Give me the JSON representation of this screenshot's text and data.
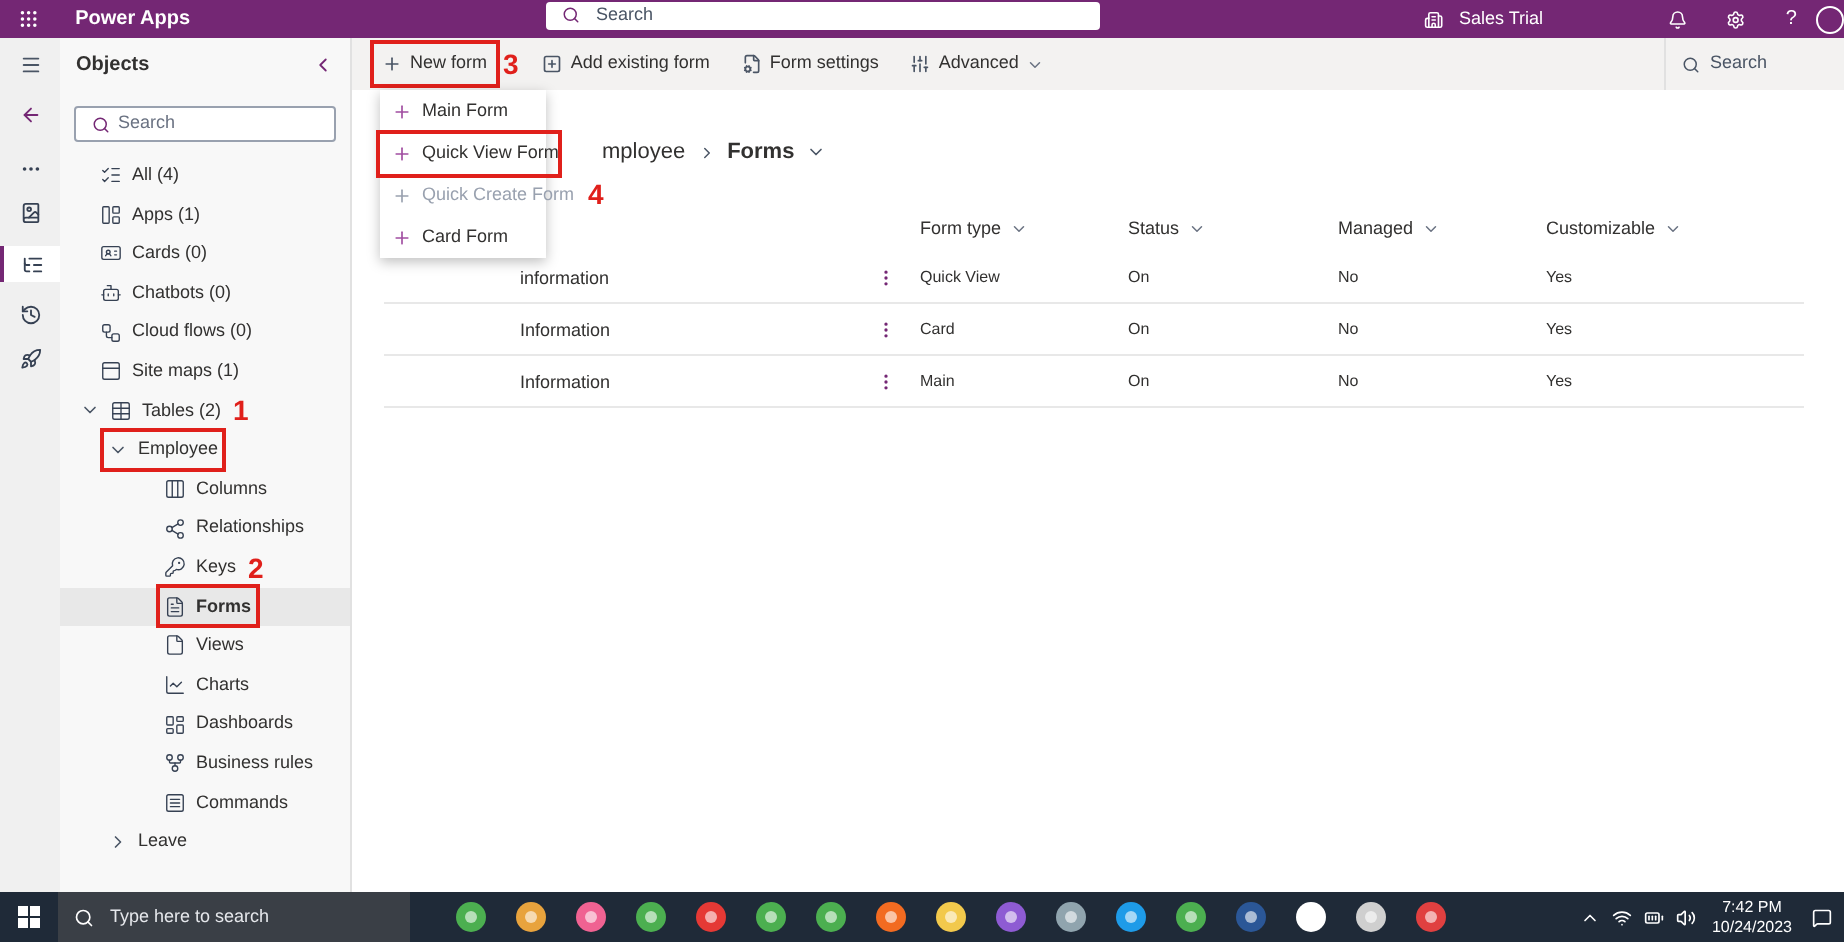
{
  "top_bar": {
    "app_name": "Power Apps",
    "search": {
      "placeholder": "Search"
    },
    "environment": "Sales Trial",
    "help": "?"
  },
  "command_bar": {
    "items": [
      {
        "label": "New form",
        "kind": "new",
        "highlighted": true,
        "annotation": "3"
      },
      {
        "label": "Add existing form",
        "kind": "add"
      },
      {
        "label": "Form settings",
        "kind": "settings"
      },
      {
        "label": "Advanced",
        "kind": "advanced"
      }
    ],
    "search": {
      "placeholder": "Search"
    }
  },
  "sidebar": {
    "title": "Objects",
    "search": {
      "placeholder": "Search"
    },
    "items": [
      {
        "label": "All (4)",
        "kind": "all"
      },
      {
        "label": "Apps (1)",
        "kind": "apps"
      },
      {
        "label": "Cards (0)",
        "kind": "cards"
      },
      {
        "label": "Chatbots (0)",
        "kind": "bot"
      },
      {
        "label": "Cloud flows (0)",
        "kind": "flow"
      },
      {
        "label": "Site maps (1)",
        "kind": "sitemap"
      },
      {
        "label": "Tables (2)",
        "kind": "table",
        "expanded": true,
        "annotation": "1",
        "children": [
          {
            "label": "Employee",
            "expanded": true,
            "highlighted": true,
            "children": [
              {
                "label": "Columns",
                "kind": "columns",
                "selected": false
              },
              {
                "label": "Relationships",
                "kind": "relationships",
                "selected": false
              },
              {
                "label": "Keys",
                "kind": "keys",
                "selected": false,
                "annotation": "2"
              },
              {
                "label": "Forms",
                "kind": "forms",
                "selected": true,
                "highlighted": true
              },
              {
                "label": "Views",
                "kind": "views",
                "selected": false
              },
              {
                "label": "Charts",
                "kind": "charts",
                "selected": false
              },
              {
                "label": "Dashboards",
                "kind": "dashboards",
                "selected": false
              },
              {
                "label": "Business rules",
                "kind": "rules",
                "selected": false
              },
              {
                "label": "Commands",
                "kind": "commands",
                "selected": false
              }
            ]
          },
          {
            "label": "Leave",
            "expanded": false
          }
        ]
      }
    ]
  },
  "new_form_menu": [
    {
      "label": "Main Form",
      "disabled": false
    },
    {
      "label": "Quick View Form",
      "disabled": false,
      "highlighted": true
    },
    {
      "label": "Quick Create Form",
      "disabled": true,
      "annotation": "4"
    },
    {
      "label": "Card Form",
      "disabled": false
    }
  ],
  "breadcrumb": [
    "mployee",
    "Forms"
  ],
  "table": {
    "columns": [
      "",
      "Form type",
      "Status",
      "Managed",
      "Customizable"
    ],
    "rows": [
      [
        "information",
        "Quick View",
        "On",
        "No",
        "Yes"
      ],
      [
        "Information",
        "Card",
        "On",
        "No",
        "Yes"
      ],
      [
        "Information",
        "Main",
        "On",
        "No",
        "Yes"
      ]
    ]
  },
  "taskbar": {
    "search": {
      "placeholder": "Type here to search"
    },
    "time": "7:42 PM",
    "date": "10/24/2023"
  }
}
